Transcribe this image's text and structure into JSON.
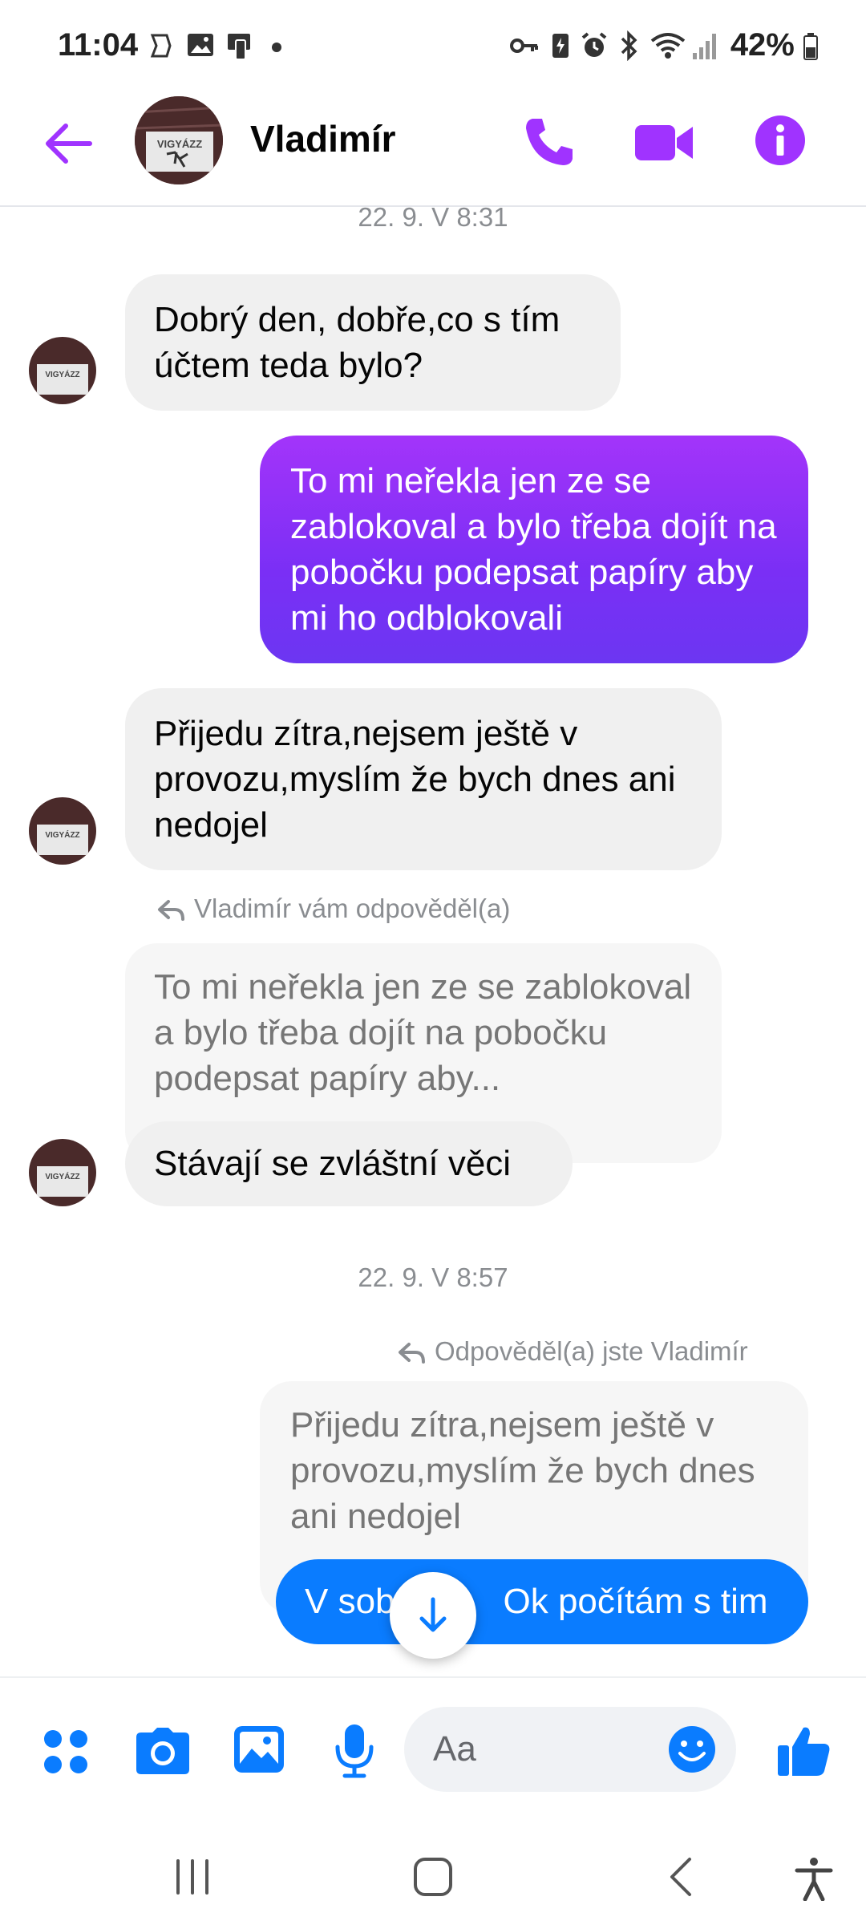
{
  "status_bar": {
    "time": "11:04",
    "battery": "42%"
  },
  "header": {
    "contact_name": "Vladimír"
  },
  "messages": {
    "timestamp_1": "22. 9. V 8:31",
    "in_1": "Dobrý den, dobře,co s tím účtem teda bylo?",
    "out_1": "To mi neřekla jen ze se zablokoval a bylo třeba dojít na pobočku podepsat papíry aby mi ho odblokovali",
    "in_2": "Přijedu zítra,nejsem ještě v provozu,myslím že bych dnes ani nedojel",
    "reply_label_1": "Vladimír vám odpověděl(a)",
    "quoted_1": "To mi neřekla jen ze se zablokoval a bylo třeba dojít na pobočku podepsat papíry aby...",
    "in_3": "Stávají se zvláštní věci",
    "timestamp_2": "22. 9. V 8:57",
    "reply_label_2": "Odpověděl(a) jste Vladimír",
    "quoted_2": "Přijedu zítra,nejsem ještě v provozu,myslím že bych dnes ani nedojel",
    "out_2_start": "V sob",
    "out_2_end": "Ok počítám s tim"
  },
  "composer": {
    "placeholder": "Aa"
  },
  "colors": {
    "accent_purple": "#a033ff",
    "messenger_blue": "#0a7cff",
    "incoming_bg": "#f0f0f0"
  },
  "icons": [
    "back-arrow-icon",
    "phone-icon",
    "video-camera-icon",
    "info-icon",
    "apps-icon",
    "camera-icon",
    "gallery-icon",
    "microphone-icon",
    "emoji-icon",
    "thumbs-up-icon",
    "scroll-down-arrow-icon",
    "recent-apps-icon",
    "home-icon",
    "back-nav-icon",
    "accessibility-icon"
  ]
}
